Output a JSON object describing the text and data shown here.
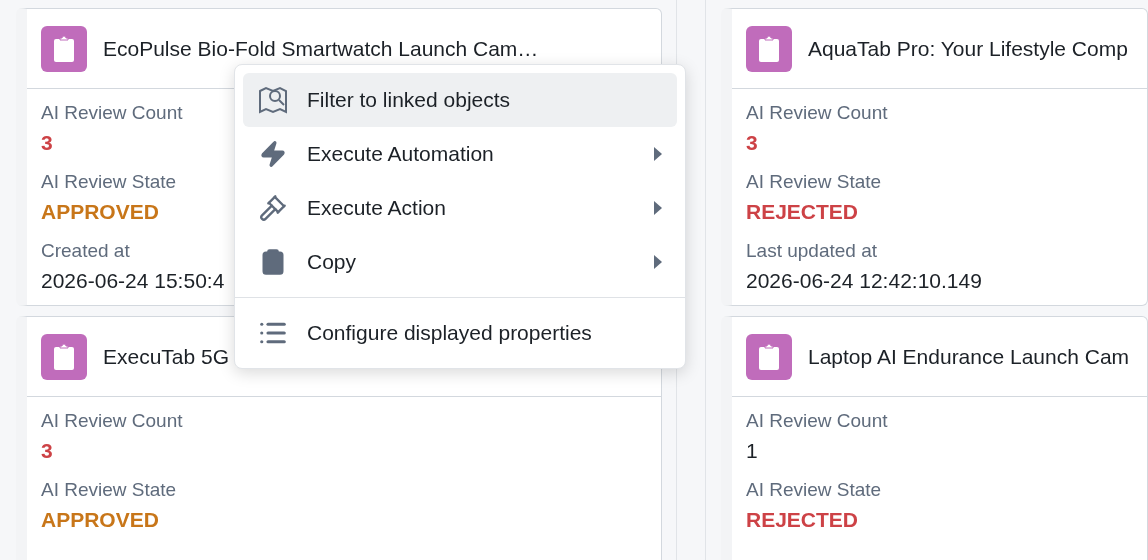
{
  "columns": [
    {
      "cards": [
        {
          "title": "EcoPulse Bio-Fold Smartwatch Launch Cam…",
          "fields": [
            {
              "label": "AI Review Count",
              "value": "3",
              "color": "#cd4246",
              "bold": true
            },
            {
              "label": "AI Review State",
              "value": "APPROVED",
              "color": "#c87619",
              "bold": true
            },
            {
              "label": "Created at",
              "value": "2026-06-24 15:50:4",
              "color": "#1c2127",
              "bold": false
            }
          ]
        },
        {
          "title": "ExecuTab 5G",
          "fields": [
            {
              "label": "AI Review Count",
              "value": "3",
              "color": "#cd4246",
              "bold": true
            },
            {
              "label": "AI Review State",
              "value": "APPROVED",
              "color": "#c87619",
              "bold": true
            }
          ]
        }
      ]
    },
    {
      "cards": [
        {
          "title": "AquaTab Pro: Your Lifestyle Comp",
          "fields": [
            {
              "label": "AI Review Count",
              "value": "3",
              "color": "#cd4246",
              "bold": true
            },
            {
              "label": "AI Review State",
              "value": "REJECTED",
              "color": "#cd4246",
              "bold": true
            },
            {
              "label": "Last updated at",
              "value": "2026-06-24 12:42:10.149",
              "color": "#1c2127",
              "bold": false
            }
          ]
        },
        {
          "title": "Laptop AI Endurance Launch Cam",
          "fields": [
            {
              "label": "AI Review Count",
              "value": "1",
              "color": "#1c2127",
              "bold": false
            },
            {
              "label": "AI Review State",
              "value": "REJECTED",
              "color": "#cd4246",
              "bold": true
            }
          ]
        }
      ]
    }
  ],
  "context_menu": {
    "items": [
      {
        "kind": "filter",
        "label": "Filter to linked objects",
        "selected": true,
        "submenu": false
      },
      {
        "kind": "automation",
        "label": "Execute Automation",
        "selected": false,
        "submenu": true
      },
      {
        "kind": "action",
        "label": "Execute Action",
        "selected": false,
        "submenu": true
      },
      {
        "kind": "copy",
        "label": "Copy",
        "selected": false,
        "submenu": true
      },
      {
        "kind": "divider"
      },
      {
        "kind": "configure",
        "label": "Configure displayed properties",
        "selected": false,
        "submenu": false
      }
    ]
  }
}
